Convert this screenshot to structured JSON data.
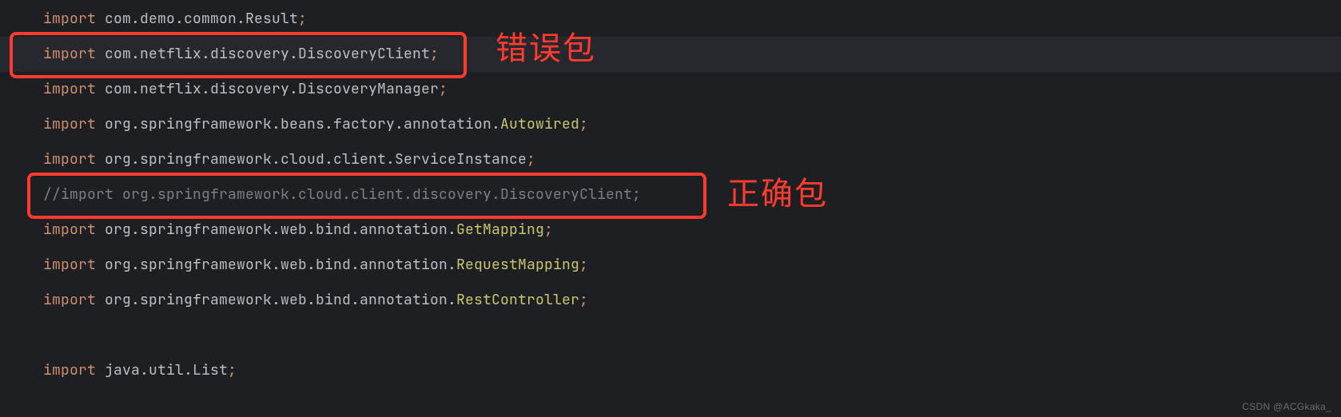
{
  "lines": [
    {
      "type": "import",
      "kw": "import",
      "pkg": "com.demo.common.",
      "cls": "Result",
      "end": ";",
      "hl": false
    },
    {
      "type": "import",
      "kw": "import",
      "pkg": "com.netflix.discovery.",
      "cls": "DiscoveryClient",
      "end": ";",
      "hl": true
    },
    {
      "type": "import",
      "kw": "import",
      "pkg": "com.netflix.discovery.",
      "cls": "DiscoveryManager",
      "end": ";",
      "hl": false
    },
    {
      "type": "import_anno",
      "kw": "import",
      "pkg": "org.springframework.beans.factory.annotation.",
      "cls": "Autowired",
      "end": ";",
      "hl": false
    },
    {
      "type": "import",
      "kw": "import",
      "pkg": "org.springframework.cloud.client.",
      "cls": "ServiceInstance",
      "end": ";",
      "hl": false
    },
    {
      "type": "comment",
      "text": "//import org.springframework.cloud.client.discovery.DiscoveryClient;",
      "hl": false
    },
    {
      "type": "import_anno",
      "kw": "import",
      "pkg": "org.springframework.web.bind.annotation.",
      "cls": "GetMapping",
      "end": ";",
      "hl": false
    },
    {
      "type": "import_anno",
      "kw": "import",
      "pkg": "org.springframework.web.bind.annotation.",
      "cls": "RequestMapping",
      "end": ";",
      "hl": false
    },
    {
      "type": "import_anno",
      "kw": "import",
      "pkg": "org.springframework.web.bind.annotation.",
      "cls": "RestController",
      "end": ";",
      "hl": false
    },
    {
      "type": "blank"
    },
    {
      "type": "import",
      "kw": "import",
      "pkg": "java.util.",
      "cls": "List",
      "end": ";",
      "hl": false
    }
  ],
  "annotations": {
    "wrong": "错误包",
    "correct": "正确包"
  },
  "watermark": "CSDN @ACGkaka_"
}
